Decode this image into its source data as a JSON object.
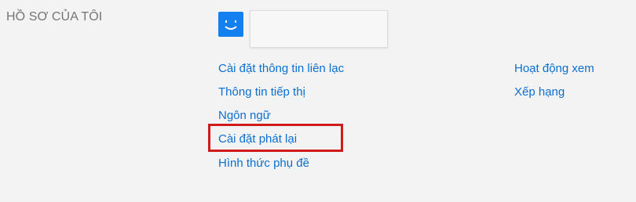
{
  "profile": {
    "heading": "HỒ SƠ CỦA TÔI",
    "avatar_icon": "smiley-face-icon",
    "avatar_color": "#1480f0",
    "profile_name": ""
  },
  "links_left": [
    {
      "label": "Cài đặt thông tin liên lạc"
    },
    {
      "label": "Thông tin tiếp thị"
    },
    {
      "label": "Ngôn ngữ"
    },
    {
      "label": "Cài đặt phát lại"
    },
    {
      "label": "Hình thức phụ đề"
    }
  ],
  "links_right": [
    {
      "label": "Hoạt động xem"
    },
    {
      "label": "Xếp hạng"
    }
  ],
  "highlight": {
    "target": "Cài đặt phát lại",
    "color": "#d11a1a"
  },
  "colors": {
    "link": "#0a6fd1",
    "heading": "#757575",
    "background": "#f3f3f3"
  }
}
